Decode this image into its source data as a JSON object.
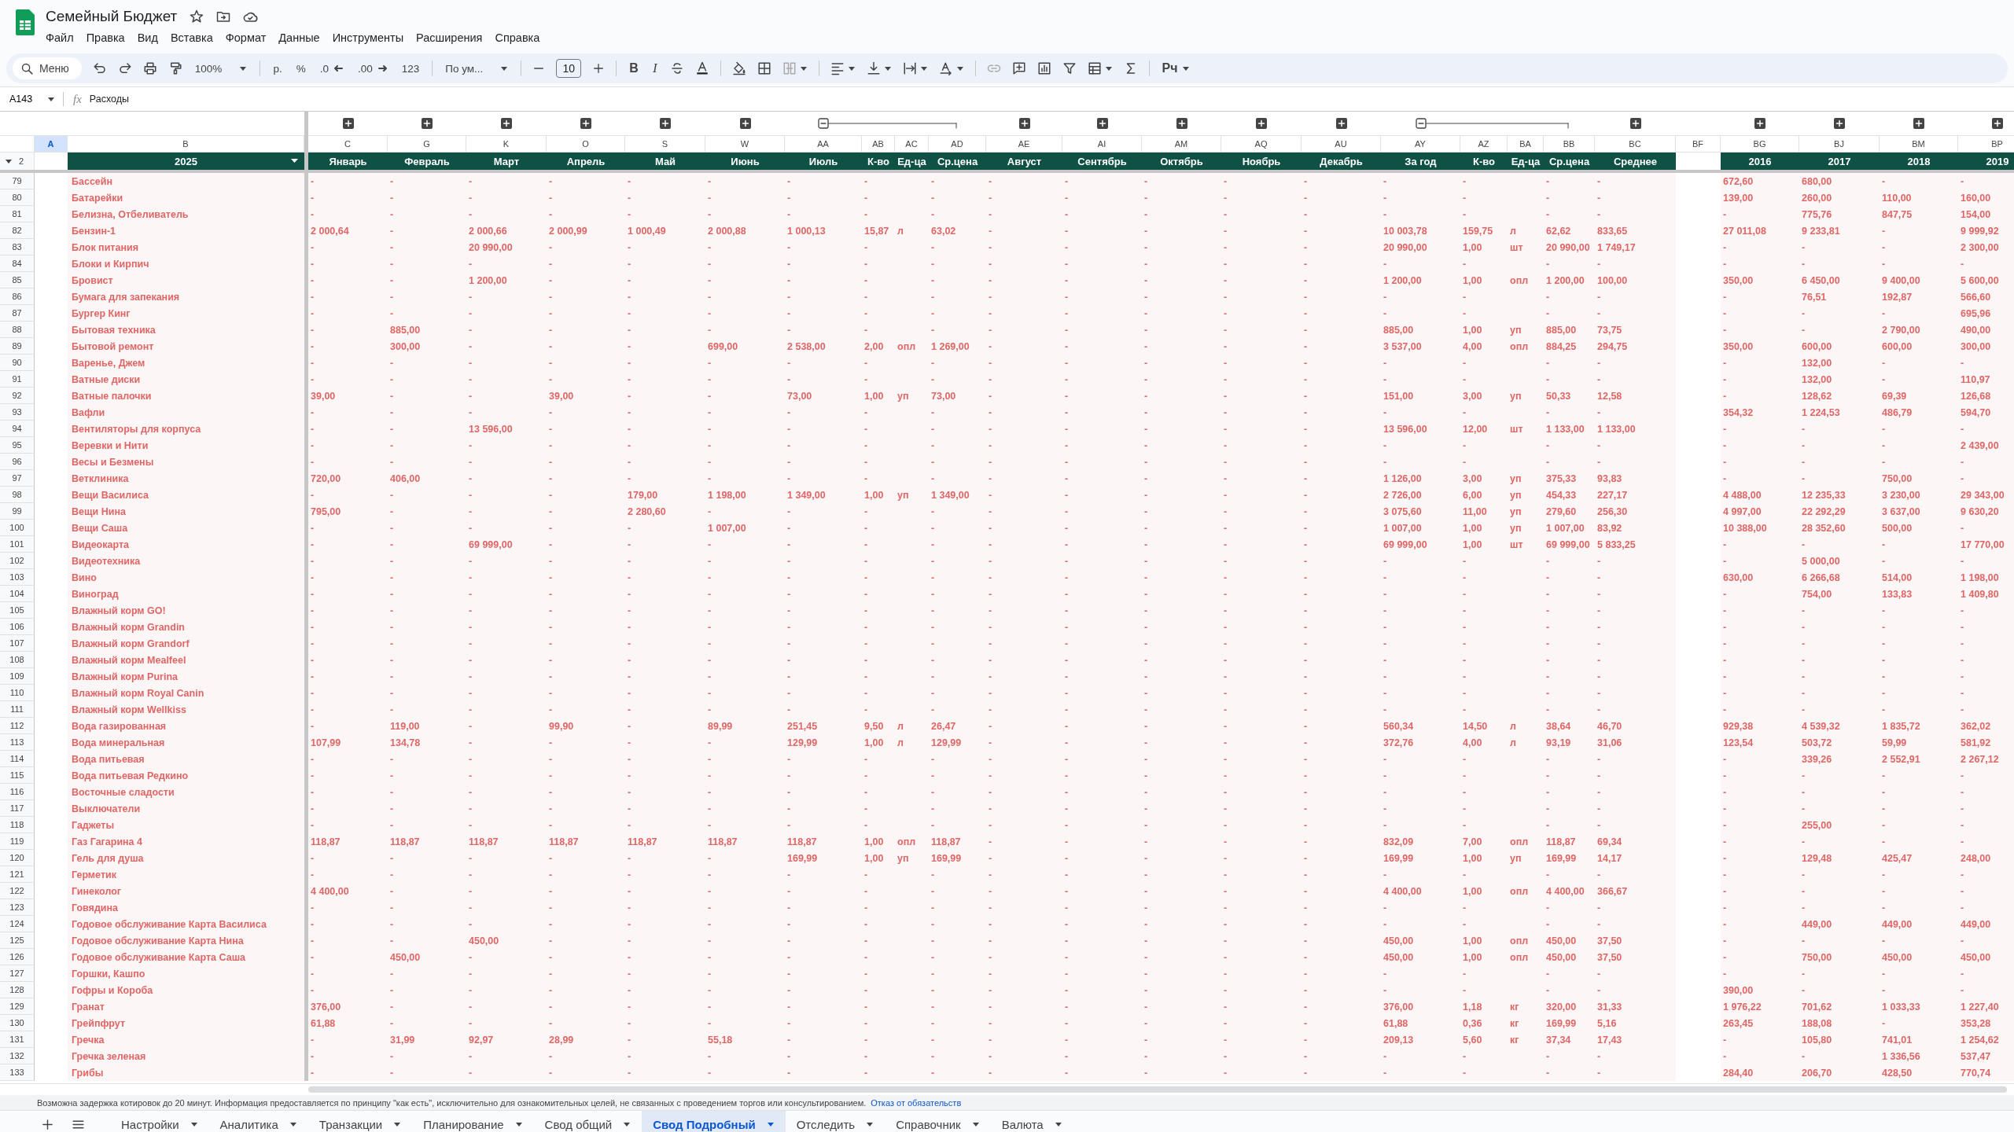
{
  "document": {
    "title": "Семейный Бюджет"
  },
  "menu": [
    "Файл",
    "Правка",
    "Вид",
    "Вставка",
    "Формат",
    "Данные",
    "Инструменты",
    "Расширения",
    "Справка"
  ],
  "toolbar": {
    "search": "Меню",
    "zoom": "100%",
    "currency": "р.",
    "percent": "%",
    "decrease_decimals": ".0",
    "increase_decimals": ".00",
    "number_format": "123",
    "font": "По ум...",
    "font_size": "10",
    "bold": "B",
    "italic": "I",
    "input_tools": "Рч"
  },
  "formula_bar": {
    "cell": "A143",
    "function_label": "fx",
    "value": "Расходы"
  },
  "frozen_row": {
    "number": "2"
  },
  "fixed_columns": [
    {
      "letter": "A",
      "selected": true
    },
    {
      "letter": "B",
      "header": "2025",
      "has_filter": true,
      "selected": false
    }
  ],
  "columns": [
    {
      "letter": "C",
      "header": "Январь",
      "group_expanded": false,
      "selected": false
    },
    {
      "letter": "G",
      "header": "Февраль",
      "group_expanded": false,
      "selected": false
    },
    {
      "letter": "K",
      "header": "Март",
      "group_expanded": false,
      "selected": false
    },
    {
      "letter": "O",
      "header": "Апрель",
      "group_expanded": false,
      "selected": false
    },
    {
      "letter": "S",
      "header": "Май",
      "group_expanded": false,
      "selected": false
    },
    {
      "letter": "W",
      "header": "Июнь",
      "group_expanded": false,
      "selected": false
    },
    {
      "letter": "AA",
      "header": "Июль",
      "group_expanded": true,
      "selected": false
    },
    {
      "letter": "AB",
      "header": "К-во",
      "selected": false
    },
    {
      "letter": "AC",
      "header": "Ед-ца",
      "selected": false
    },
    {
      "letter": "AD",
      "header": "Ср.цена",
      "selected": false
    },
    {
      "letter": "AE",
      "header": "Август",
      "group_expanded": false,
      "selected": false
    },
    {
      "letter": "AI",
      "header": "Сентябрь",
      "group_expanded": false,
      "selected": false
    },
    {
      "letter": "AM",
      "header": "Октябрь",
      "group_expanded": false,
      "selected": false
    },
    {
      "letter": "AQ",
      "header": "Ноябрь",
      "group_expanded": false,
      "selected": false
    },
    {
      "letter": "AU",
      "header": "Декабрь",
      "group_expanded": false,
      "selected": false
    },
    {
      "letter": "AY",
      "header": "За год",
      "group_expanded": true,
      "selected": false
    },
    {
      "letter": "AZ",
      "header": "К-во",
      "selected": false
    },
    {
      "letter": "BA",
      "header": "Ед-ца",
      "selected": false
    },
    {
      "letter": "BB",
      "header": "Ср.цена",
      "selected": false
    },
    {
      "letter": "BC",
      "header": "Среднее",
      "group_expanded": false,
      "selected": false
    },
    {
      "letter": "BF",
      "selected": false
    },
    {
      "letter": "BG",
      "header": "2016",
      "group_expanded": false,
      "selected": false
    },
    {
      "letter": "BJ",
      "header": "2017",
      "group_expanded": false,
      "selected": false
    },
    {
      "letter": "BM",
      "header": "2018",
      "group_expanded": false,
      "selected": false
    },
    {
      "letter": "BP",
      "header": "2019",
      "group_expanded": false,
      "selected": false
    }
  ],
  "rows": [
    {
      "number": "79",
      "name": "Бассейн",
      "cells": [
        "-",
        "-",
        "-",
        "-",
        "-",
        "-",
        "-",
        "-",
        null,
        "-",
        "-",
        "-",
        "-",
        "-",
        "-",
        "-",
        "-",
        null,
        "-",
        "-",
        null,
        "672,60",
        "680,00",
        "-",
        "-"
      ]
    },
    {
      "number": "80",
      "name": "Батарейки",
      "cells": [
        "-",
        "-",
        "-",
        "-",
        "-",
        "-",
        "-",
        "-",
        null,
        "-",
        "-",
        "-",
        "-",
        "-",
        "-",
        "-",
        "-",
        null,
        "-",
        "-",
        null,
        "139,00",
        "260,00",
        "110,00",
        "160,00"
      ]
    },
    {
      "number": "81",
      "name": "Белизна, Отбеливатель",
      "cells": [
        "-",
        "-",
        "-",
        "-",
        "-",
        "-",
        "-",
        "-",
        null,
        "-",
        "-",
        "-",
        "-",
        "-",
        "-",
        "-",
        "-",
        null,
        "-",
        "-",
        null,
        "-",
        "775,76",
        "847,75",
        "154,00"
      ]
    },
    {
      "number": "82",
      "name": "Бензин-1",
      "cells": [
        "2 000,64",
        "-",
        "2 000,66",
        "2 000,99",
        "1 000,49",
        "2 000,88",
        "1 000,13",
        "15,87",
        "л",
        "63,02",
        "-",
        "-",
        "-",
        "-",
        "-",
        "10 003,78",
        "159,75",
        "л",
        "62,62",
        "833,65",
        null,
        "27 011,08",
        "9 233,81",
        "-",
        "9 999,92"
      ]
    },
    {
      "number": "83",
      "name": "Блок питания",
      "cells": [
        "-",
        "-",
        "20 990,00",
        "-",
        "-",
        "-",
        "-",
        "-",
        null,
        "-",
        "-",
        "-",
        "-",
        "-",
        "-",
        "20 990,00",
        "1,00",
        "шт",
        "20 990,00",
        "1 749,17",
        null,
        "-",
        "-",
        "-",
        "2 300,00"
      ]
    },
    {
      "number": "84",
      "name": "Блоки и Кирпич",
      "cells": [
        "-",
        "-",
        "-",
        "-",
        "-",
        "-",
        "-",
        "-",
        null,
        "-",
        "-",
        "-",
        "-",
        "-",
        "-",
        "-",
        "-",
        null,
        "-",
        "-",
        null,
        "-",
        "-",
        "-",
        "-"
      ]
    },
    {
      "number": "85",
      "name": "Бровист",
      "cells": [
        "-",
        "-",
        "1 200,00",
        "-",
        "-",
        "-",
        "-",
        "-",
        null,
        "-",
        "-",
        "-",
        "-",
        "-",
        "-",
        "1 200,00",
        "1,00",
        "опл",
        "1 200,00",
        "100,00",
        null,
        "350,00",
        "6 450,00",
        "9 400,00",
        "5 600,00"
      ]
    },
    {
      "number": "86",
      "name": "Бумага для запекания",
      "cells": [
        "-",
        "-",
        "-",
        "-",
        "-",
        "-",
        "-",
        "-",
        null,
        "-",
        "-",
        "-",
        "-",
        "-",
        "-",
        "-",
        "-",
        null,
        "-",
        "-",
        null,
        "-",
        "76,51",
        "192,87",
        "566,60"
      ]
    },
    {
      "number": "87",
      "name": "Бургер Кинг",
      "cells": [
        "-",
        "-",
        "-",
        "-",
        "-",
        "-",
        "-",
        "-",
        null,
        "-",
        "-",
        "-",
        "-",
        "-",
        "-",
        "-",
        "-",
        null,
        "-",
        "-",
        null,
        "-",
        "-",
        "-",
        "695,96"
      ]
    },
    {
      "number": "88",
      "name": "Бытовая техника",
      "cells": [
        "-",
        "885,00",
        "-",
        "-",
        "-",
        "-",
        "-",
        "-",
        null,
        "-",
        "-",
        "-",
        "-",
        "-",
        "-",
        "885,00",
        "1,00",
        "уп",
        "885,00",
        "73,75",
        null,
        "-",
        "-",
        "2 790,00",
        "490,00"
      ]
    },
    {
      "number": "89",
      "name": "Бытовой ремонт",
      "cells": [
        "-",
        "300,00",
        "-",
        "-",
        "-",
        "699,00",
        "2 538,00",
        "2,00",
        "опл",
        "1 269,00",
        "-",
        "-",
        "-",
        "-",
        "-",
        "3 537,00",
        "4,00",
        "опл",
        "884,25",
        "294,75",
        null,
        "350,00",
        "600,00",
        "600,00",
        "300,00"
      ]
    },
    {
      "number": "90",
      "name": "Варенье, Джем",
      "cells": [
        "-",
        "-",
        "-",
        "-",
        "-",
        "-",
        "-",
        "-",
        null,
        "-",
        "-",
        "-",
        "-",
        "-",
        "-",
        "-",
        "-",
        null,
        "-",
        "-",
        null,
        "-",
        "132,00",
        "-",
        "-"
      ]
    },
    {
      "number": "91",
      "name": "Ватные диски",
      "cells": [
        "-",
        "-",
        "-",
        "-",
        "-",
        "-",
        "-",
        "-",
        null,
        "-",
        "-",
        "-",
        "-",
        "-",
        "-",
        "-",
        "-",
        null,
        "-",
        "-",
        null,
        "-",
        "132,00",
        "-",
        "110,97"
      ]
    },
    {
      "number": "92",
      "name": "Ватные палочки",
      "cells": [
        "39,00",
        "-",
        "-",
        "39,00",
        "-",
        "-",
        "73,00",
        "1,00",
        "уп",
        "73,00",
        "-",
        "-",
        "-",
        "-",
        "-",
        "151,00",
        "3,00",
        "уп",
        "50,33",
        "12,58",
        null,
        "-",
        "128,62",
        "69,39",
        "126,68"
      ]
    },
    {
      "number": "93",
      "name": "Вафли",
      "cells": [
        "-",
        "-",
        "-",
        "-",
        "-",
        "-",
        "-",
        "-",
        null,
        "-",
        "-",
        "-",
        "-",
        "-",
        "-",
        "-",
        "-",
        null,
        "-",
        "-",
        null,
        "354,32",
        "1 224,53",
        "486,79",
        "594,70"
      ]
    },
    {
      "number": "94",
      "name": "Вентиляторы для корпуса",
      "cells": [
        "-",
        "-",
        "13 596,00",
        "-",
        "-",
        "-",
        "-",
        "-",
        null,
        "-",
        "-",
        "-",
        "-",
        "-",
        "-",
        "13 596,00",
        "12,00",
        "шт",
        "1 133,00",
        "1 133,00",
        null,
        "-",
        "-",
        "-",
        "-"
      ]
    },
    {
      "number": "95",
      "name": "Веревки и Нити",
      "cells": [
        "-",
        "-",
        "-",
        "-",
        "-",
        "-",
        "-",
        "-",
        null,
        "-",
        "-",
        "-",
        "-",
        "-",
        "-",
        "-",
        "-",
        null,
        "-",
        "-",
        null,
        "-",
        "-",
        "-",
        "2 439,00"
      ]
    },
    {
      "number": "96",
      "name": "Весы и Безмены",
      "cells": [
        "-",
        "-",
        "-",
        "-",
        "-",
        "-",
        "-",
        "-",
        null,
        "-",
        "-",
        "-",
        "-",
        "-",
        "-",
        "-",
        "-",
        null,
        "-",
        "-",
        null,
        "-",
        "-",
        "-",
        "-"
      ]
    },
    {
      "number": "97",
      "name": "Ветклиника",
      "cells": [
        "720,00",
        "406,00",
        "-",
        "-",
        "-",
        "-",
        "-",
        "-",
        null,
        "-",
        "-",
        "-",
        "-",
        "-",
        "-",
        "1 126,00",
        "3,00",
        "уп",
        "375,33",
        "93,83",
        null,
        "-",
        "-",
        "750,00",
        "-"
      ]
    },
    {
      "number": "98",
      "name": "Вещи Василиса",
      "cells": [
        "-",
        "-",
        "-",
        "-",
        "179,00",
        "1 198,00",
        "1 349,00",
        "1,00",
        "уп",
        "1 349,00",
        "-",
        "-",
        "-",
        "-",
        "-",
        "2 726,00",
        "6,00",
        "уп",
        "454,33",
        "227,17",
        null,
        "4 488,00",
        "12 235,33",
        "3 230,00",
        "29 343,00"
      ]
    },
    {
      "number": "99",
      "name": "Вещи Нина",
      "cells": [
        "795,00",
        "-",
        "-",
        "-",
        "2 280,60",
        "-",
        "-",
        "-",
        null,
        "-",
        "-",
        "-",
        "-",
        "-",
        "-",
        "3 075,60",
        "11,00",
        "уп",
        "279,60",
        "256,30",
        null,
        "4 997,00",
        "22 292,29",
        "3 637,00",
        "9 630,20"
      ]
    },
    {
      "number": "100",
      "name": "Вещи Саша",
      "cells": [
        "-",
        "-",
        "-",
        "-",
        "-",
        "1 007,00",
        "-",
        "-",
        null,
        "-",
        "-",
        "-",
        "-",
        "-",
        "-",
        "1 007,00",
        "1,00",
        "уп",
        "1 007,00",
        "83,92",
        null,
        "10 388,00",
        "28 352,60",
        "500,00",
        "-"
      ]
    },
    {
      "number": "101",
      "name": "Видеокарта",
      "cells": [
        "-",
        "-",
        "69 999,00",
        "-",
        "-",
        "-",
        "-",
        "-",
        null,
        "-",
        "-",
        "-",
        "-",
        "-",
        "-",
        "69 999,00",
        "1,00",
        "шт",
        "69 999,00",
        "5 833,25",
        null,
        "-",
        "-",
        "-",
        "17 770,00"
      ]
    },
    {
      "number": "102",
      "name": "Видеотехника",
      "cells": [
        "-",
        "-",
        "-",
        "-",
        "-",
        "-",
        "-",
        "-",
        null,
        "-",
        "-",
        "-",
        "-",
        "-",
        "-",
        "-",
        "-",
        null,
        "-",
        "-",
        null,
        "-",
        "5 000,00",
        "-",
        "-"
      ]
    },
    {
      "number": "103",
      "name": "Вино",
      "cells": [
        "-",
        "-",
        "-",
        "-",
        "-",
        "-",
        "-",
        "-",
        null,
        "-",
        "-",
        "-",
        "-",
        "-",
        "-",
        "-",
        "-",
        null,
        "-",
        "-",
        null,
        "630,00",
        "6 266,68",
        "514,00",
        "1 198,00"
      ]
    },
    {
      "number": "104",
      "name": "Виноград",
      "cells": [
        "-",
        "-",
        "-",
        "-",
        "-",
        "-",
        "-",
        "-",
        null,
        "-",
        "-",
        "-",
        "-",
        "-",
        "-",
        "-",
        "-",
        null,
        "-",
        "-",
        null,
        "-",
        "754,00",
        "133,83",
        "1 409,80"
      ]
    },
    {
      "number": "105",
      "name": "Влажный корм GO!",
      "cells": [
        "-",
        "-",
        "-",
        "-",
        "-",
        "-",
        "-",
        "-",
        null,
        "-",
        "-",
        "-",
        "-",
        "-",
        "-",
        "-",
        "-",
        null,
        "-",
        "-",
        null,
        "-",
        "-",
        "-",
        "-"
      ]
    },
    {
      "number": "106",
      "name": "Влажный корм Grandin",
      "cells": [
        "-",
        "-",
        "-",
        "-",
        "-",
        "-",
        "-",
        "-",
        null,
        "-",
        "-",
        "-",
        "-",
        "-",
        "-",
        "-",
        "-",
        null,
        "-",
        "-",
        null,
        "-",
        "-",
        "-",
        "-"
      ]
    },
    {
      "number": "107",
      "name": "Влажный корм Grandorf",
      "cells": [
        "-",
        "-",
        "-",
        "-",
        "-",
        "-",
        "-",
        "-",
        null,
        "-",
        "-",
        "-",
        "-",
        "-",
        "-",
        "-",
        "-",
        null,
        "-",
        "-",
        null,
        "-",
        "-",
        "-",
        "-"
      ]
    },
    {
      "number": "108",
      "name": "Влажный корм Mealfeel",
      "cells": [
        "-",
        "-",
        "-",
        "-",
        "-",
        "-",
        "-",
        "-",
        null,
        "-",
        "-",
        "-",
        "-",
        "-",
        "-",
        "-",
        "-",
        null,
        "-",
        "-",
        null,
        "-",
        "-",
        "-",
        "-"
      ]
    },
    {
      "number": "109",
      "name": "Влажный корм Purina",
      "cells": [
        "-",
        "-",
        "-",
        "-",
        "-",
        "-",
        "-",
        "-",
        null,
        "-",
        "-",
        "-",
        "-",
        "-",
        "-",
        "-",
        "-",
        null,
        "-",
        "-",
        null,
        "-",
        "-",
        "-",
        "-"
      ]
    },
    {
      "number": "110",
      "name": "Влажный корм Royal Canin",
      "cells": [
        "-",
        "-",
        "-",
        "-",
        "-",
        "-",
        "-",
        "-",
        null,
        "-",
        "-",
        "-",
        "-",
        "-",
        "-",
        "-",
        "-",
        null,
        "-",
        "-",
        null,
        "-",
        "-",
        "-",
        "-"
      ]
    },
    {
      "number": "111",
      "name": "Влажный корм Wellkiss",
      "cells": [
        "-",
        "-",
        "-",
        "-",
        "-",
        "-",
        "-",
        "-",
        null,
        "-",
        "-",
        "-",
        "-",
        "-",
        "-",
        "-",
        "-",
        null,
        "-",
        "-",
        null,
        "-",
        "-",
        "-",
        "-"
      ]
    },
    {
      "number": "112",
      "name": "Вода газированная",
      "cells": [
        "-",
        "119,00",
        "-",
        "99,90",
        "-",
        "89,99",
        "251,45",
        "9,50",
        "л",
        "26,47",
        "-",
        "-",
        "-",
        "-",
        "-",
        "560,34",
        "14,50",
        "л",
        "38,64",
        "46,70",
        null,
        "929,38",
        "4 539,32",
        "1 835,72",
        "362,02"
      ]
    },
    {
      "number": "113",
      "name": "Вода минеральная",
      "cells": [
        "107,99",
        "134,78",
        "-",
        "-",
        "-",
        "-",
        "129,99",
        "1,00",
        "л",
        "129,99",
        "-",
        "-",
        "-",
        "-",
        "-",
        "372,76",
        "4,00",
        "л",
        "93,19",
        "31,06",
        null,
        "123,54",
        "503,72",
        "59,99",
        "581,92"
      ]
    },
    {
      "number": "114",
      "name": "Вода питьевая",
      "cells": [
        "-",
        "-",
        "-",
        "-",
        "-",
        "-",
        "-",
        "-",
        null,
        "-",
        "-",
        "-",
        "-",
        "-",
        "-",
        "-",
        "-",
        null,
        "-",
        "-",
        null,
        "-",
        "339,26",
        "2 552,91",
        "2 267,12"
      ]
    },
    {
      "number": "115",
      "name": "Вода питьевая Редкино",
      "cells": [
        "-",
        "-",
        "-",
        "-",
        "-",
        "-",
        "-",
        "-",
        null,
        "-",
        "-",
        "-",
        "-",
        "-",
        "-",
        "-",
        "-",
        null,
        "-",
        "-",
        null,
        "-",
        "-",
        "-",
        "-"
      ]
    },
    {
      "number": "116",
      "name": "Восточные сладости",
      "cells": [
        "-",
        "-",
        "-",
        "-",
        "-",
        "-",
        "-",
        "-",
        null,
        "-",
        "-",
        "-",
        "-",
        "-",
        "-",
        "-",
        "-",
        null,
        "-",
        "-",
        null,
        "-",
        "-",
        "-",
        "-"
      ]
    },
    {
      "number": "117",
      "name": "Выключатели",
      "cells": [
        "-",
        "-",
        "-",
        "-",
        "-",
        "-",
        "-",
        "-",
        null,
        "-",
        "-",
        "-",
        "-",
        "-",
        "-",
        "-",
        "-",
        null,
        "-",
        "-",
        null,
        "-",
        "-",
        "-",
        "-"
      ]
    },
    {
      "number": "118",
      "name": "Гаджеты",
      "cells": [
        "-",
        "-",
        "-",
        "-",
        "-",
        "-",
        "-",
        "-",
        null,
        "-",
        "-",
        "-",
        "-",
        "-",
        "-",
        "-",
        "-",
        null,
        "-",
        "-",
        null,
        "-",
        "255,00",
        "-",
        "-"
      ]
    },
    {
      "number": "119",
      "name": "Газ Гагарина 4",
      "cells": [
        "118,87",
        "118,87",
        "118,87",
        "118,87",
        "118,87",
        "118,87",
        "118,87",
        "1,00",
        "опл",
        "118,87",
        "-",
        "-",
        "-",
        "-",
        "-",
        "832,09",
        "7,00",
        "опл",
        "118,87",
        "69,34",
        null,
        "-",
        "-",
        "-",
        "-"
      ]
    },
    {
      "number": "120",
      "name": "Гель для душа",
      "cells": [
        "-",
        "-",
        "-",
        "-",
        "-",
        "-",
        "169,99",
        "1,00",
        "уп",
        "169,99",
        "-",
        "-",
        "-",
        "-",
        "-",
        "169,99",
        "1,00",
        "уп",
        "169,99",
        "14,17",
        null,
        "-",
        "129,48",
        "425,47",
        "248,00"
      ]
    },
    {
      "number": "121",
      "name": "Герметик",
      "cells": [
        "-",
        "-",
        "-",
        "-",
        "-",
        "-",
        "-",
        "-",
        null,
        "-",
        "-",
        "-",
        "-",
        "-",
        "-",
        "-",
        "-",
        null,
        "-",
        "-",
        null,
        "-",
        "-",
        "-",
        "-"
      ]
    },
    {
      "number": "122",
      "name": "Гинеколог",
      "cells": [
        "4 400,00",
        "-",
        "-",
        "-",
        "-",
        "-",
        "-",
        "-",
        null,
        "-",
        "-",
        "-",
        "-",
        "-",
        "-",
        "4 400,00",
        "1,00",
        "опл",
        "4 400,00",
        "366,67",
        null,
        "-",
        "-",
        "-",
        "-"
      ]
    },
    {
      "number": "123",
      "name": "Говядина",
      "cells": [
        "-",
        "-",
        "-",
        "-",
        "-",
        "-",
        "-",
        "-",
        null,
        "-",
        "-",
        "-",
        "-",
        "-",
        "-",
        "-",
        "-",
        null,
        "-",
        "-",
        null,
        "-",
        "-",
        "-",
        "-"
      ]
    },
    {
      "number": "124",
      "name": "Годовое обслуживание Карта Василиса",
      "cells": [
        "-",
        "-",
        "-",
        "-",
        "-",
        "-",
        "-",
        "-",
        null,
        "-",
        "-",
        "-",
        "-",
        "-",
        "-",
        "-",
        "-",
        null,
        "-",
        "-",
        null,
        "-",
        "449,00",
        "449,00",
        "449,00"
      ]
    },
    {
      "number": "125",
      "name": "Годовое обслуживание Карта Нина",
      "cells": [
        "-",
        "-",
        "450,00",
        "-",
        "-",
        "-",
        "-",
        "-",
        null,
        "-",
        "-",
        "-",
        "-",
        "-",
        "-",
        "450,00",
        "1,00",
        "опл",
        "450,00",
        "37,50",
        null,
        "-",
        "-",
        "-",
        "-"
      ]
    },
    {
      "number": "126",
      "name": "Годовое обслуживание Карта Саша",
      "cells": [
        "-",
        "450,00",
        "-",
        "-",
        "-",
        "-",
        "-",
        "-",
        null,
        "-",
        "-",
        "-",
        "-",
        "-",
        "-",
        "450,00",
        "1,00",
        "опл",
        "450,00",
        "37,50",
        null,
        "-",
        "750,00",
        "450,00",
        "450,00"
      ]
    },
    {
      "number": "127",
      "name": "Горшки, Кашпо",
      "cells": [
        "-",
        "-",
        "-",
        "-",
        "-",
        "-",
        "-",
        "-",
        null,
        "-",
        "-",
        "-",
        "-",
        "-",
        "-",
        "-",
        "-",
        null,
        "-",
        "-",
        null,
        "-",
        "-",
        "-",
        "-"
      ]
    },
    {
      "number": "128",
      "name": "Гофры и Короба",
      "cells": [
        "-",
        "-",
        "-",
        "-",
        "-",
        "-",
        "-",
        "-",
        null,
        "-",
        "-",
        "-",
        "-",
        "-",
        "-",
        "-",
        "-",
        null,
        "-",
        "-",
        null,
        "390,00",
        "-",
        "-",
        "-"
      ]
    },
    {
      "number": "129",
      "name": "Гранат",
      "cells": [
        "376,00",
        "-",
        "-",
        "-",
        "-",
        "-",
        "-",
        "-",
        null,
        "-",
        "-",
        "-",
        "-",
        "-",
        "-",
        "376,00",
        "1,18",
        "кг",
        "320,00",
        "31,33",
        null,
        "1 976,22",
        "701,62",
        "1 033,33",
        "1 227,40"
      ]
    },
    {
      "number": "130",
      "name": "Грейпфрут",
      "cells": [
        "61,88",
        "-",
        "-",
        "-",
        "-",
        "-",
        "-",
        "-",
        null,
        "-",
        "-",
        "-",
        "-",
        "-",
        "-",
        "61,88",
        "0,36",
        "кг",
        "169,99",
        "5,16",
        null,
        "263,45",
        "188,08",
        "-",
        "353,28"
      ]
    },
    {
      "number": "131",
      "name": "Гречка",
      "cells": [
        "-",
        "31,99",
        "92,97",
        "28,99",
        "-",
        "55,18",
        "-",
        "-",
        null,
        "-",
        "-",
        "-",
        "-",
        "-",
        "-",
        "209,13",
        "5,60",
        "кг",
        "37,34",
        "17,43",
        null,
        "-",
        "105,80",
        "741,01",
        "1 254,62"
      ]
    },
    {
      "number": "132",
      "name": "Гречка зеленая",
      "cells": [
        "-",
        "-",
        "-",
        "-",
        "-",
        "-",
        "-",
        "-",
        null,
        "-",
        "-",
        "-",
        "-",
        "-",
        "-",
        "-",
        "-",
        null,
        "-",
        "-",
        null,
        "-",
        "-",
        "1 336,56",
        "537,47"
      ]
    },
    {
      "number": "133",
      "name": "Грибы",
      "cells": [
        "-",
        "-",
        "-",
        "-",
        "-",
        "-",
        "-",
        "-",
        null,
        "-",
        "-",
        "-",
        "-",
        "-",
        "-",
        "-",
        "-",
        null,
        "-",
        "-",
        null,
        "284,40",
        "206,70",
        "428,50",
        "770,74"
      ]
    }
  ],
  "disclaimer": {
    "text": "Возможна задержка котировок до 20 минут. Информация предоставляется по принципу \"как есть\", исключительно для ознакомительных целей, не связанных с проведением торгов или консультированием.",
    "link": "Отказ от обязательств"
  },
  "sheet_tabs": [
    {
      "label": "Настройки",
      "selected": false
    },
    {
      "label": "Аналитика",
      "selected": false
    },
    {
      "label": "Транзакции",
      "selected": false
    },
    {
      "label": "Планирование",
      "selected": false
    },
    {
      "label": "Свод общий",
      "selected": false
    },
    {
      "label": "Свод Подробный",
      "selected": true
    },
    {
      "label": "Отследить",
      "selected": false
    },
    {
      "label": "Справочник",
      "selected": false
    },
    {
      "label": "Валюта",
      "selected": false
    }
  ]
}
